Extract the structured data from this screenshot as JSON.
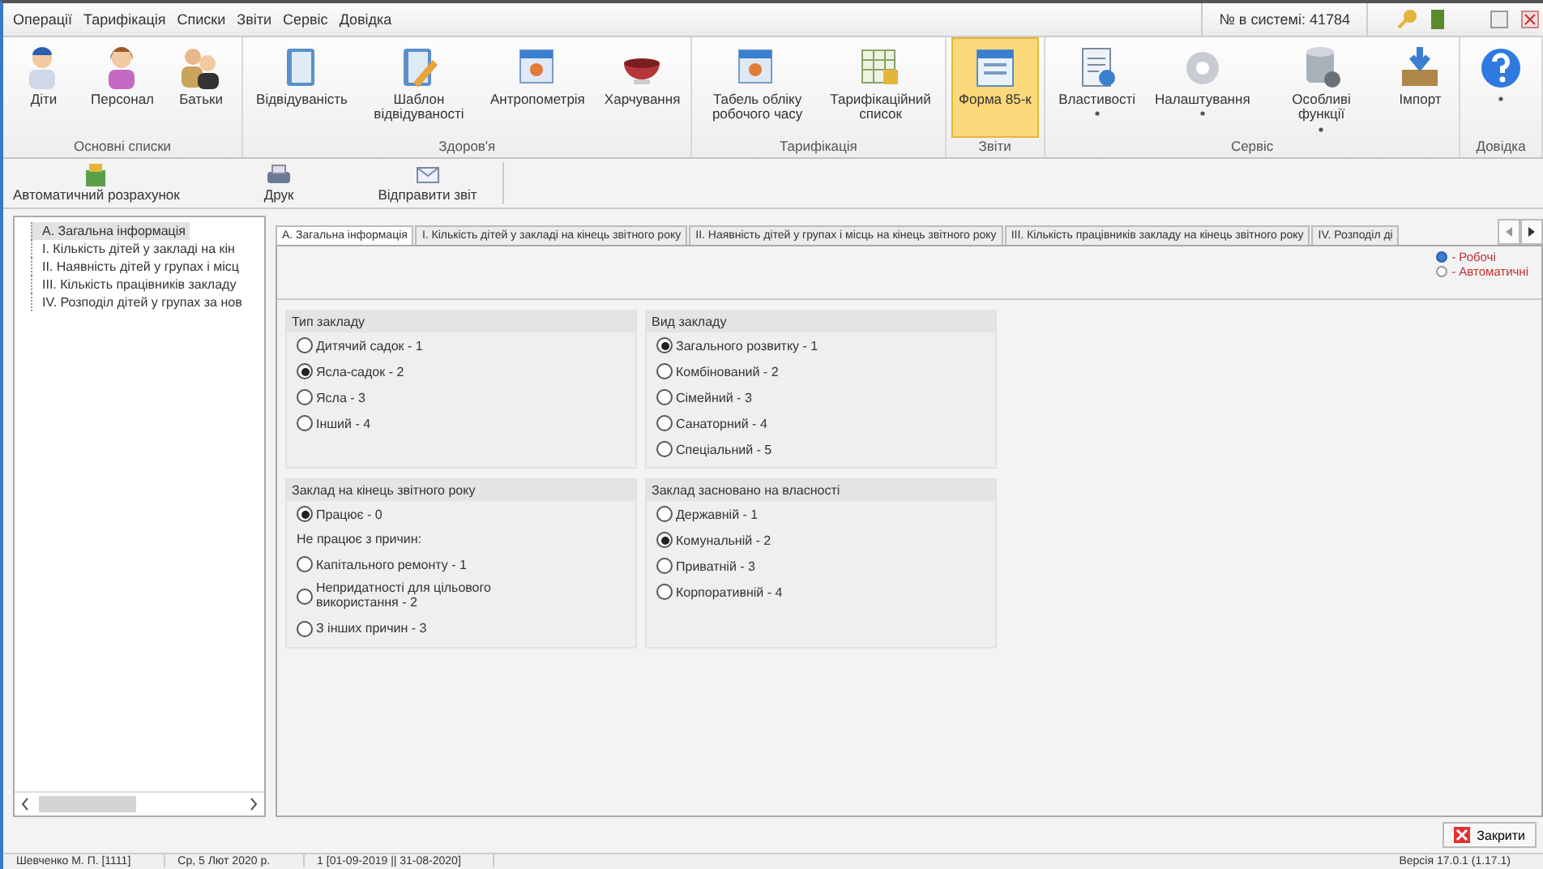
{
  "menu": [
    "Операції",
    "Тарифікація",
    "Списки",
    "Звіти",
    "Сервіс",
    "Довідка"
  ],
  "system_number": "№ в системі: 41784",
  "ribbon": [
    {
      "label": "Основні списки",
      "items": [
        {
          "label": "Діти",
          "selected": false
        },
        {
          "label": "Персонал",
          "selected": false
        },
        {
          "label": "Батьки",
          "selected": false
        }
      ]
    },
    {
      "label": "Здоров'я",
      "items": [
        {
          "label": "Відвідуваність",
          "selected": false
        },
        {
          "label": "Шаблон відвідуваності",
          "selected": false
        },
        {
          "label": "Антропометрія",
          "selected": false
        },
        {
          "label": "Харчування",
          "selected": false
        }
      ]
    },
    {
      "label": "Тарифікація",
      "items": [
        {
          "label": "Табель обліку робочого часу",
          "selected": false
        },
        {
          "label": "Тарифікаційний список",
          "selected": false
        }
      ]
    },
    {
      "label": "Звіти",
      "items": [
        {
          "label": "Форма 85-к",
          "selected": true
        }
      ]
    },
    {
      "label": "Сервіс",
      "items": [
        {
          "label": "Властивості",
          "selected": false,
          "dropdown": true
        },
        {
          "label": "Налаштування",
          "selected": false,
          "dropdown": true
        },
        {
          "label": "Особливі функції",
          "selected": false,
          "dropdown": true
        },
        {
          "label": "Імпорт",
          "selected": false
        }
      ]
    },
    {
      "label": "Довідка",
      "items": [
        {
          "selected": false,
          "dropdown": true
        }
      ]
    }
  ],
  "toolbar": [
    {
      "label": "Автоматичний розрахунок"
    },
    {
      "label": "Друк"
    },
    {
      "label": "Відправити звіт"
    }
  ],
  "tree": [
    {
      "label": "А. Загальна інформація",
      "selected": true
    },
    {
      "label": "І. Кількість дітей у закладі на кін",
      "selected": false
    },
    {
      "label": "ІІ. Наявність дітей у групах і місц",
      "selected": false
    },
    {
      "label": "ІІІ. Кількість працівників закладу",
      "selected": false
    },
    {
      "label": "ІV. Розподіл дітей у групах за нов",
      "selected": false
    }
  ],
  "tabs": [
    {
      "label": "А. Загальна інформація",
      "selected": true
    },
    {
      "label": "І. Кількість дітей у закладі на кінець звітного року",
      "selected": false
    },
    {
      "label": "ІІ. Наявність дітей у групах і місць на кінець звітного року",
      "selected": false
    },
    {
      "label": "ІІІ. Кількість працівників закладу на кінець звітного року",
      "selected": false
    },
    {
      "label": "ІV. Розподіл ді",
      "selected": false
    }
  ],
  "mode": [
    {
      "label": "- Робочі",
      "selected": true
    },
    {
      "label": "- Автоматичні",
      "selected": false
    }
  ],
  "groups": [
    {
      "title": "Тип закладу",
      "options": [
        {
          "kind": "radio",
          "label": "Дитячий садок - 1",
          "selected": false
        },
        {
          "kind": "radio",
          "label": "Ясла-садок - 2",
          "selected": true
        },
        {
          "kind": "radio",
          "label": "Ясла - 3",
          "selected": false
        },
        {
          "kind": "radio",
          "label": "Інший - 4",
          "selected": false
        }
      ]
    },
    {
      "title": "Вид закладу",
      "options": [
        {
          "kind": "radio",
          "label": "Загального розвитку - 1",
          "selected": true
        },
        {
          "kind": "radio",
          "label": "Комбінований - 2",
          "selected": false
        },
        {
          "kind": "radio",
          "label": "Сімейний - 3",
          "selected": false
        },
        {
          "kind": "radio",
          "label": "Санаторний - 4",
          "selected": false
        },
        {
          "kind": "radio",
          "label": "Спеціальний - 5",
          "selected": false
        }
      ]
    },
    {
      "title": "Заклад на кінець звітного року",
      "options": [
        {
          "kind": "radio",
          "label": "Працює - 0",
          "selected": true
        },
        {
          "kind": "note",
          "label": "Не працює з причин:"
        },
        {
          "kind": "radio",
          "label": "Капітального ремонту - 1",
          "selected": false
        },
        {
          "kind": "radio",
          "label": "Непридатності для цільового використання - 2",
          "selected": false
        },
        {
          "kind": "radio",
          "label": "З інших причин - 3",
          "selected": false
        }
      ]
    },
    {
      "title": "Заклад засновано на власності",
      "options": [
        {
          "kind": "radio",
          "label": "Державній - 1",
          "selected": false
        },
        {
          "kind": "radio",
          "label": "Комунальній - 2",
          "selected": true
        },
        {
          "kind": "radio",
          "label": "Приватній - 3",
          "selected": false
        },
        {
          "kind": "radio",
          "label": "Корпоративній - 4",
          "selected": false
        }
      ]
    }
  ],
  "close_button": "Закрити",
  "status_bar": [
    "Шевченко М. П. [1111]",
    "Ср, 5 Лют 2020 р.",
    "1 [01-09-2019 || 31-08-2020]",
    "Версія 17.0.1 (1.17.1)"
  ]
}
